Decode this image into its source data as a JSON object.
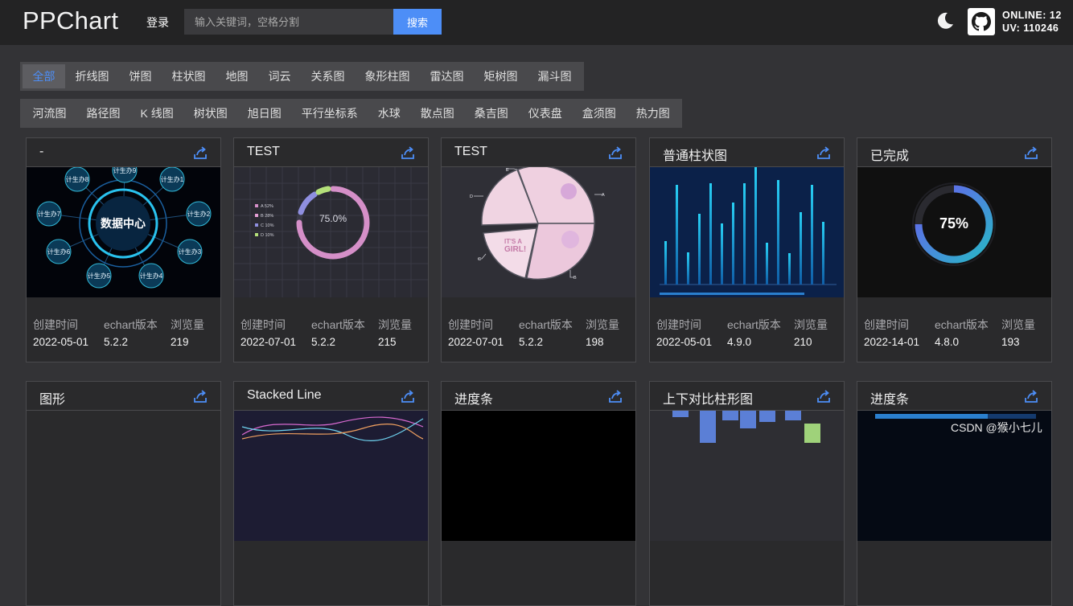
{
  "header": {
    "logo": "PPChart",
    "login_label": "登录",
    "search_placeholder": "输入关键词，空格分割",
    "search_button": "搜索",
    "online_label": "ONLINE:",
    "online_value": "12",
    "uv_label": "UV:",
    "uv_value": "110246",
    "theme_icon": "moon-icon",
    "github_icon": "github-icon"
  },
  "categories_row1": [
    "全部",
    "折线图",
    "饼图",
    "柱状图",
    "地图",
    "词云",
    "关系图",
    "象形柱图",
    "雷达图",
    "矩树图",
    "漏斗图"
  ],
  "categories_row2": [
    "河流图",
    "路径图",
    "K 线图",
    "树状图",
    "旭日图",
    "平行坐标系",
    "水球",
    "散点图",
    "桑吉图",
    "仪表盘",
    "盒须图",
    "热力图"
  ],
  "active_category": "全部",
  "meta_labels": {
    "created": "创建时间",
    "version": "echart版本",
    "views": "浏览量"
  },
  "cards_row1": [
    {
      "title": "-",
      "created": "2022-05-01",
      "version": "5.2.2",
      "views": "219",
      "thumb_center": "数据中心",
      "thumb_nodes": [
        "计生办9",
        "计生办1",
        "计生办2",
        "计生办3",
        "计生办4",
        "计生办5",
        "计生办6",
        "计生办7",
        "计生办8"
      ]
    },
    {
      "title": "TEST",
      "created": "2022-07-01",
      "version": "5.2.2",
      "views": "215",
      "thumb_percent": "75.0%",
      "thumb_legend": [
        "A 52%",
        "B 28%",
        "C 10%",
        "D 10%"
      ]
    },
    {
      "title": "TEST",
      "created": "2022-07-01",
      "version": "5.2.2",
      "views": "198",
      "thumb_labels": [
        "E",
        "A",
        "B",
        "C",
        "D"
      ]
    },
    {
      "title": "普通柱状图",
      "created": "2022-05-01",
      "version": "4.9.0",
      "views": "210"
    },
    {
      "title": "已完成",
      "created": "2022-14-01",
      "version": "4.8.0",
      "views": "193",
      "thumb_percent": "75%",
      "progress": 0.75
    }
  ],
  "cards_row2": [
    {
      "title": "图形"
    },
    {
      "title": "Stacked Line"
    },
    {
      "title": "进度条"
    },
    {
      "title": "上下对比柱形图"
    },
    {
      "title": "进度条"
    }
  ],
  "watermark": "CSDN @猴小七儿",
  "colors": {
    "accent": "#4d8ef7",
    "topbar": "#232324",
    "page": "#333336",
    "card": "#2a2a2c"
  }
}
